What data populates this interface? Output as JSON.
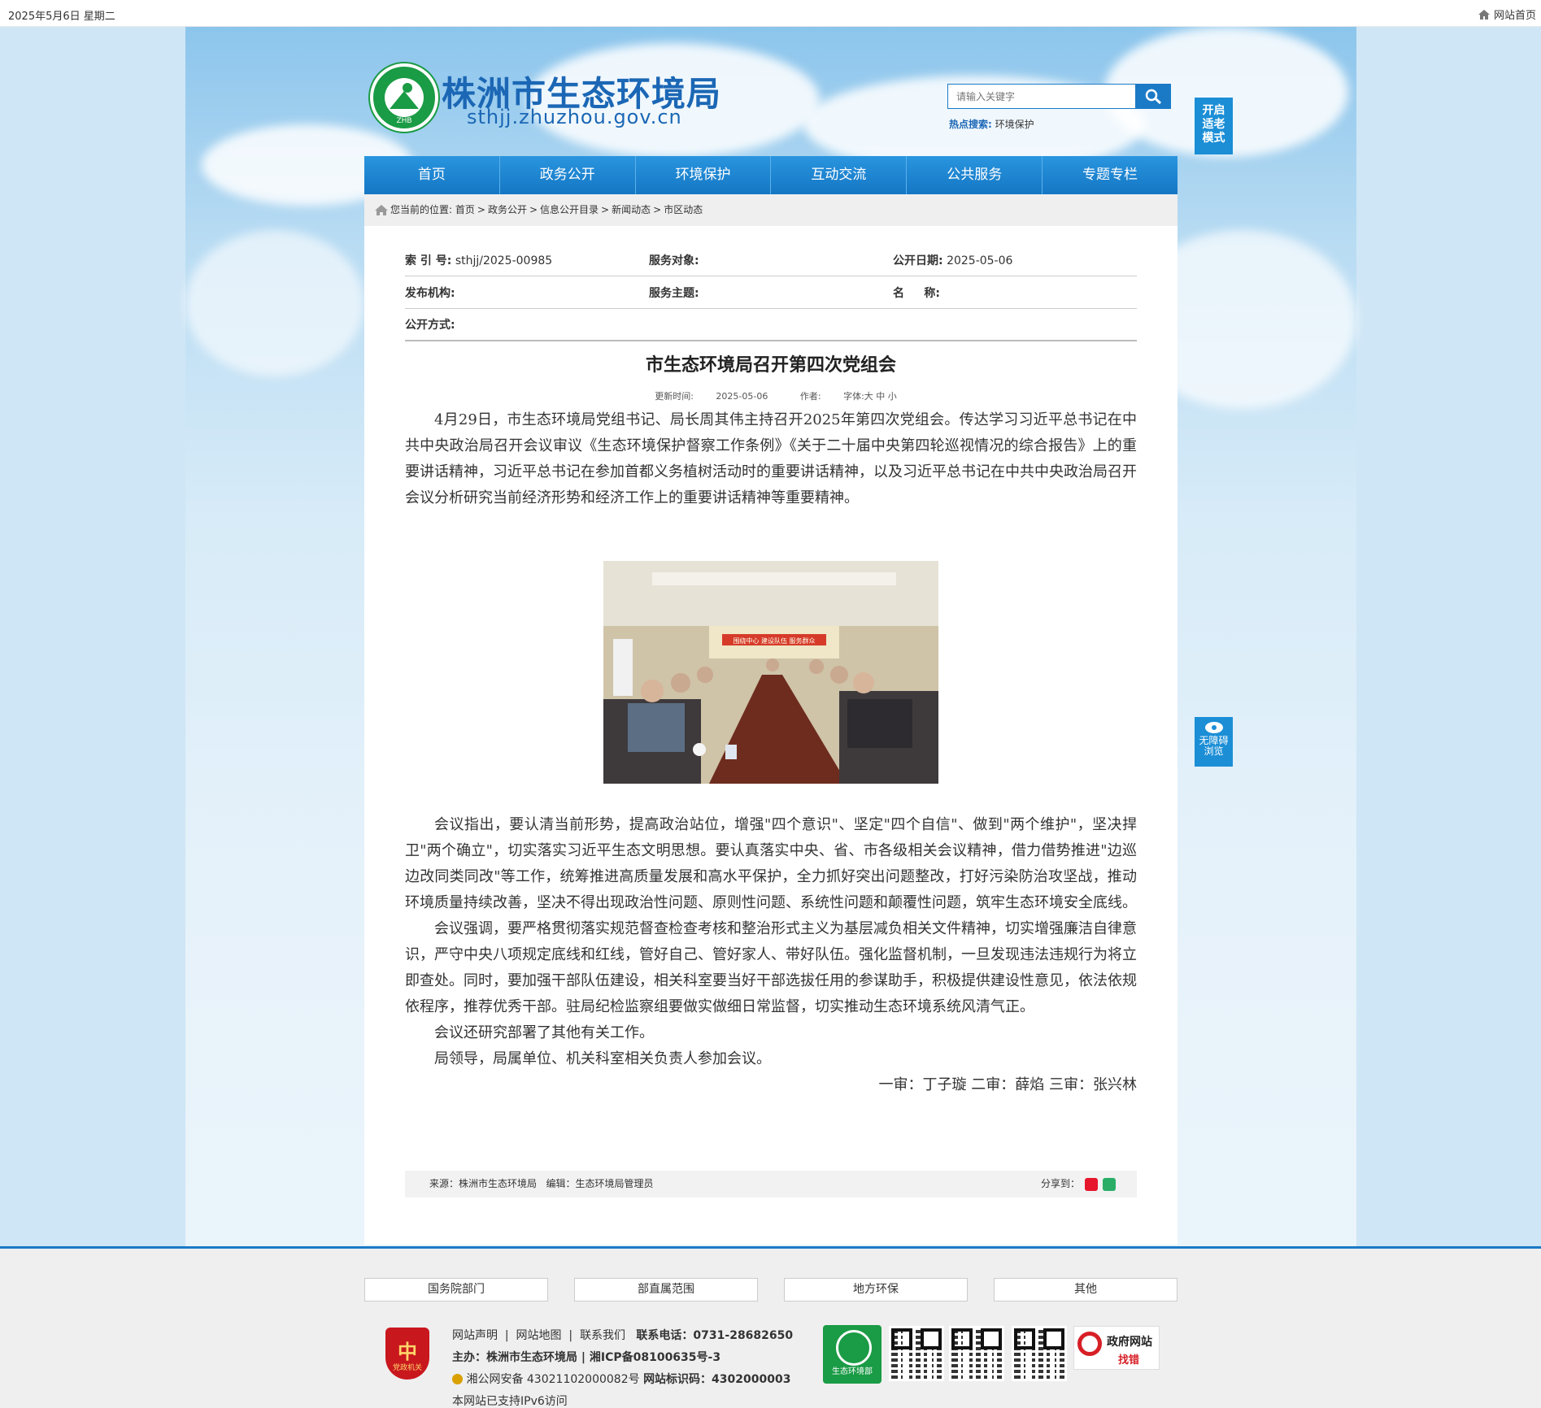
{
  "topbar": {
    "date": "2025年5月6日 星期二",
    "home_link": "网站首页"
  },
  "header": {
    "site_name": "株洲市生态环境局",
    "site_domain": "sthjj.zhuzhou.gov.cn",
    "logo_abbr": "ZHB",
    "search_placeholder": "请输入关键字",
    "hot_label": "热点搜索:",
    "hot_keyword": "环境保护",
    "elder_mode": [
      "开启",
      "适老",
      "模式"
    ],
    "accessibility": [
      "无障碍",
      "浏览"
    ]
  },
  "nav": [
    "首页",
    "政务公开",
    "环境保护",
    "互动交流",
    "公共服务",
    "专题专栏"
  ],
  "breadcrumb": {
    "prefix": "您当前的位置:",
    "items": [
      "首页",
      "政务公开",
      "信息公开目录",
      "新闻动态",
      "市区动态"
    ]
  },
  "meta": {
    "index_label": "索 引 号:",
    "index_value": "sthjj/2025-00985",
    "target_label": "服务对象:",
    "target_value": "",
    "date_label": "公开日期:",
    "date_value": "2025-05-06",
    "org_label": "发布机构:",
    "org_value": "",
    "topic_label": "服务主题:",
    "topic_value": "",
    "name_label": "名     称:",
    "name_value": "",
    "method_label": "公开方式:",
    "method_value": ""
  },
  "article": {
    "title": "市生态环境局召开第四次党组会",
    "update_label": "更新时间:",
    "update_value": "2025-05-06",
    "author_label": "作者:",
    "font_label": "字体:大 中 小",
    "p1": "4月29日，市生态环境局党组书记、局长周其伟主持召开2025年第四次党组会。传达学习习近平总书记在中共中央政治局召开会议审议《生态环境保护督察工作条例》《关于二十届中央第四轮巡视情况的综合报告》上的重要讲话精神，习近平总书记在参加首都义务植树活动时的重要讲话精神，以及习近平总书记在中共中央政治局召开会议分析研究当前经济形势和经济工作上的重要讲话精神等重要精神。",
    "photo_banner": "围绕中心 建设队伍 服务群众",
    "p2": "会议指出，要认清当前形势，提高政治站位，增强\"四个意识\"、坚定\"四个自信\"、做到\"两个维护\"，坚决捍卫\"两个确立\"，切实落实习近平生态文明思想。要认真落实中央、省、市各级相关会议精神，借力借势推进\"边巡边改同类同改\"等工作，统筹推进高质量发展和高水平保护，全力抓好突出问题整改，打好污染防治攻坚战，推动环境质量持续改善，坚决不得出现政治性问题、原则性问题、系统性问题和颠覆性问题，筑牢生态环境安全底线。",
    "p3": "会议强调，要严格贯彻落实规范督查检查考核和整治形式主义为基层减负相关文件精神，切实增强廉洁自律意识，严守中央八项规定底线和红线，管好自己、管好家人、带好队伍。强化监督机制，一旦发现违法违规行为将立即查处。同时，要加强干部队伍建设，相关科室要当好干部选拔任用的参谋助手，积极提供建设性意见，依法依规依程序，推荐优秀干部。驻局纪检监察组要做实做细日常监督，切实推动生态环境系统风清气正。",
    "p4": "会议还研究部署了其他有关工作。",
    "p5": "局领导，局属单位、机关科室相关负责人参加会议。",
    "sign": "一审：丁子璇 二审：薛焰 三审：张兴林",
    "source": "来源：株洲市生态环境局   编辑：生态环境局管理员",
    "share_label": "分享到："
  },
  "footer": {
    "links": [
      "国务院部门",
      "部直属范围",
      "地方环保",
      "其他"
    ],
    "badge_text": "党政机关",
    "nav_line": [
      "网站声明",
      "网站地图",
      "联系我们"
    ],
    "phone": "联系电话：0731-28682650",
    "host": "主办：株洲市生态环境局 | 湘ICP备08100635号-3",
    "police": "湘公网安备 43021102000082号",
    "site_id": "网站标识码：4302000003",
    "ipv6": "本网站已支持IPv6访问",
    "zhb_label": "生态环境部",
    "zhaocuo_1": "政府网站",
    "zhaocuo_2": "找错"
  }
}
